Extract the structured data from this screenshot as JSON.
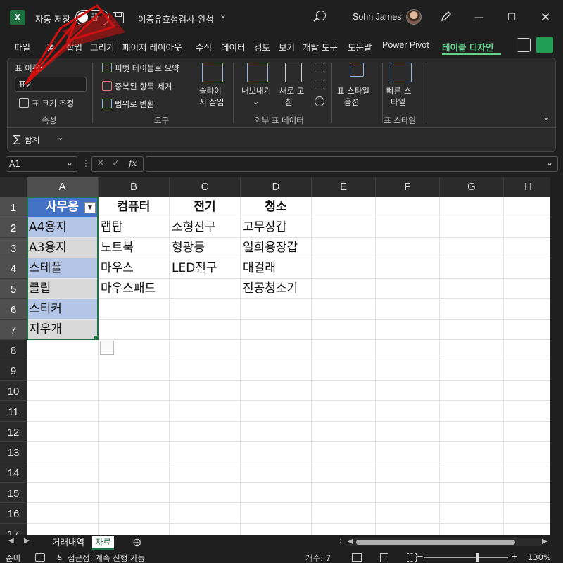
{
  "titlebar": {
    "autosave_label": "자동 저장",
    "autosave_state": "끔",
    "document_title": "이중유효성검사-완성",
    "user_name": "Sohn James"
  },
  "tabs": [
    "파일",
    "홈",
    "삽입",
    "그리기",
    "페이지 레이아웃",
    "수식",
    "데이터",
    "검토",
    "보기",
    "개발 도구",
    "도움말",
    "Power Pivot",
    "테이블 디자인"
  ],
  "active_tab": "테이블 디자인",
  "ribbon": {
    "properties": {
      "table_name_label": "표 이름:",
      "table_name_value": "표2",
      "resize_label": "표 크기 조정",
      "group_label": "속성"
    },
    "tools": {
      "pivot_label": "피벗 테이블로 요약",
      "remove_dup_label": "중복된 항목 제거",
      "convert_label": "범위로 변환",
      "slicer_label_1": "슬라이",
      "slicer_label_2": "서 삽입",
      "group_label": "도구"
    },
    "external": {
      "export_label": "내보내기",
      "refresh_label_1": "새로 고",
      "refresh_label_2": "침",
      "group_label": "외부 표 데이터"
    },
    "style_options": {
      "label_1": "표 스타일",
      "label_2": "옵션"
    },
    "styles": {
      "quick_label_1": "빠른 스",
      "quick_label_2": "타일",
      "group_label": "표 스타일"
    },
    "total_label": "합계"
  },
  "formula_bar": {
    "name_box": "A1",
    "fx": "fx",
    "formula": ""
  },
  "grid": {
    "columns": [
      "A",
      "B",
      "C",
      "D",
      "E",
      "F",
      "G",
      "H"
    ],
    "rows": [
      "1",
      "2",
      "3",
      "4",
      "5",
      "6",
      "7",
      "8",
      "9",
      "10",
      "11",
      "12",
      "13",
      "14",
      "15",
      "16",
      "17"
    ],
    "cells": {
      "A1": "사무용",
      "B1": "컴퓨터",
      "C1": "전기",
      "D1": "청소",
      "A2": "A4용지",
      "B2": "랩탑",
      "C2": "소형전구",
      "D2": "고무장갑",
      "A3": "A3용지",
      "B3": "노트북",
      "C3": "형광등",
      "D3": "일회용장갑",
      "A4": "스테플",
      "B4": "마우스",
      "C4": "LED전구",
      "D4": "대걸래",
      "A5": "클립",
      "B5": "마우스패드",
      "D5": "진공청소기",
      "A6": "스티커",
      "A7": "지우개"
    }
  },
  "sheets": {
    "tabs": [
      "거래내역",
      "자료"
    ],
    "active": "자료"
  },
  "status": {
    "ready": "준비",
    "accessibility": "접근성: 계속 진행 가능",
    "count": "개수: 7",
    "zoom": "130%"
  },
  "colors": {
    "accent_green": "#217346",
    "tab_active": "#5fd38d",
    "table_header_blue": "#4472c4",
    "band_blue": "#b4c6e7",
    "band_gray": "#d9d9d9",
    "annotation_red": "#d01010"
  }
}
